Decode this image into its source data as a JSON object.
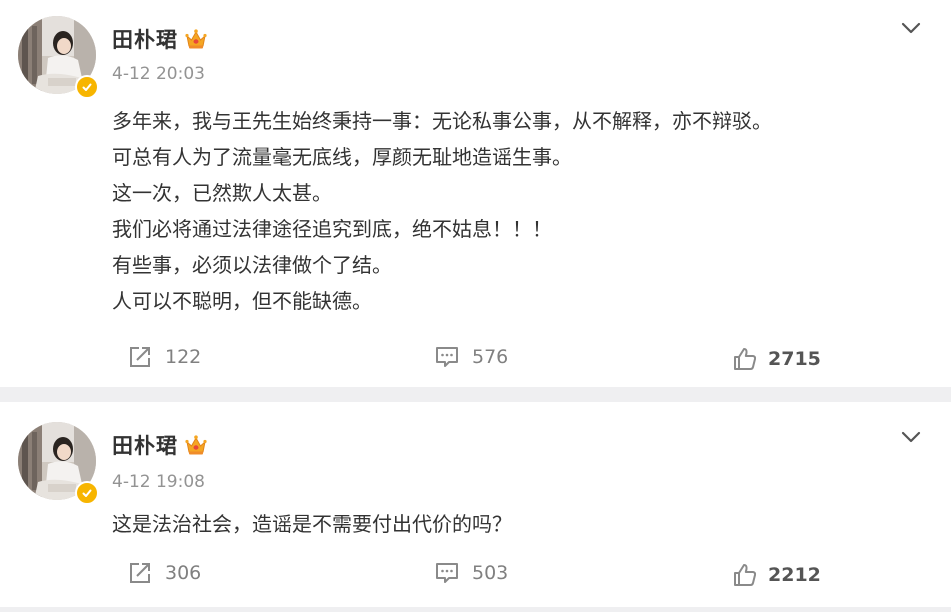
{
  "posts": [
    {
      "author": "田朴珺",
      "time": "4-12 20:03",
      "lines": [
        "多年来，我与王先生始终秉持一事：无论私事公事，从不解释，亦不辩驳。",
        "可总有人为了流量毫无底线，厚颜无耻地造谣生事。",
        "这一次，已然欺人太甚。",
        "我们必将通过法律途径追究到底，绝不姑息！！！",
        "有些事，必须以法律做个了结。",
        "人可以不聪明，但不能缺德。"
      ],
      "reposts": "122",
      "comments": "576",
      "likes": "2715"
    },
    {
      "author": "田朴珺",
      "time": "4-12 19:08",
      "lines": [
        "这是法治社会，造谣是不需要付出代价的吗？"
      ],
      "reposts": "306",
      "comments": "503",
      "likes": "2212"
    }
  ],
  "icons": {
    "verified": "verified-badge-icon",
    "member": "crown-icon",
    "more": "chevron-down-icon",
    "repost": "repost-icon",
    "comment": "comment-icon",
    "like": "thumbs-up-icon"
  },
  "colors": {
    "text": "#333333",
    "muted": "#939393",
    "badge": "#f7b500",
    "divider": "#efeff1"
  }
}
